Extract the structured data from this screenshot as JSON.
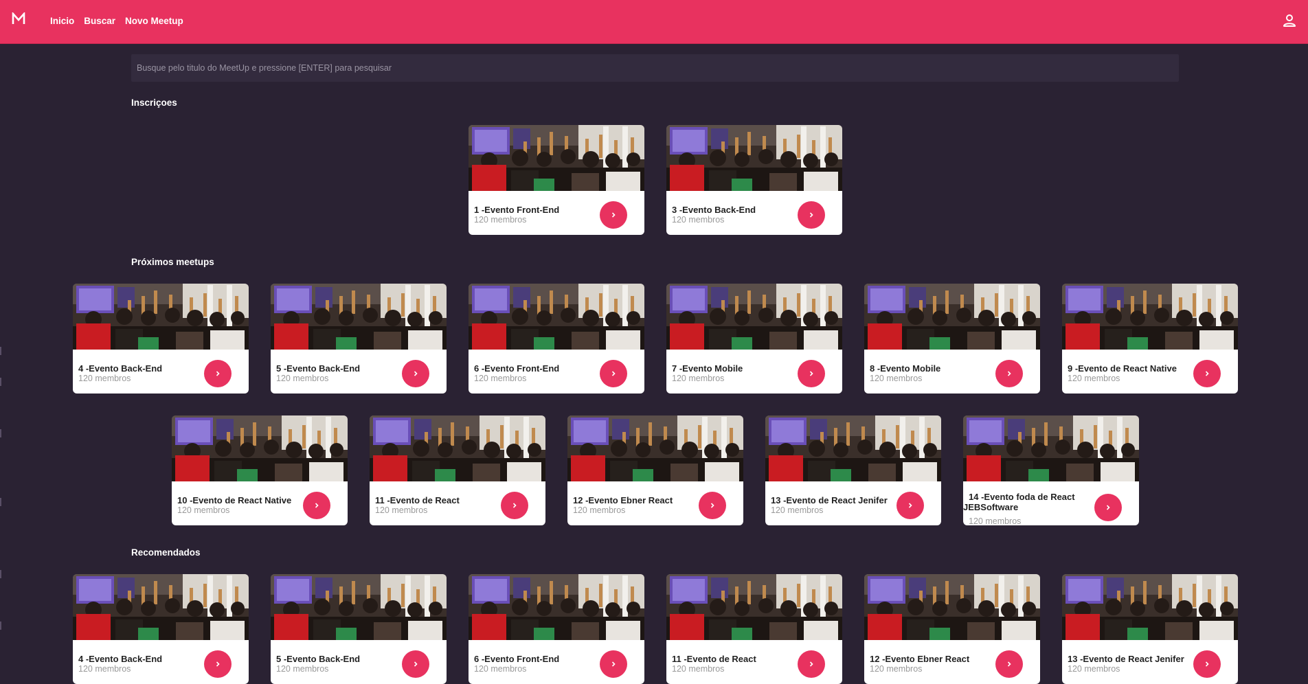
{
  "nav": {
    "logo": "M",
    "items": [
      "Inicio",
      "Buscar",
      "Novo Meetup"
    ]
  },
  "search": {
    "placeholder": "Busque pelo titulo do MeetUp e pressione [ENTER] para pesquisar"
  },
  "sections": {
    "inscricoes": {
      "title": "Inscriçoes",
      "cards": [
        {
          "title": "1 -Evento Front-End",
          "members": "120 membros"
        },
        {
          "title": "3 -Evento Back-End",
          "members": "120 membros"
        }
      ]
    },
    "proximos": {
      "title": "Próximos meetups",
      "cards": [
        {
          "title": "4 -Evento Back-End",
          "members": "120 membros"
        },
        {
          "title": "5 -Evento Back-End",
          "members": "120 membros"
        },
        {
          "title": "6 -Evento Front-End",
          "members": "120 membros"
        },
        {
          "title": "7 -Evento Mobile",
          "members": "120 membros"
        },
        {
          "title": "8 -Evento Mobile",
          "members": "120 membros"
        },
        {
          "title": "9 -Evento de React Native",
          "members": "120 membros"
        },
        {
          "title": "10 -Evento de React Native",
          "members": "120 membros"
        },
        {
          "title": "11 -Evento de React",
          "members": "120 membros"
        },
        {
          "title": "12 -Evento Ebner React",
          "members": "120 membros"
        },
        {
          "title": "13 -Evento de React Jenifer",
          "members": "120 membros"
        },
        {
          "title": "14 -Evento foda de React JEBSoftware",
          "members": "120 membros"
        }
      ]
    },
    "recomendados": {
      "title": "Recomendados",
      "cards": [
        {
          "title": "4 -Evento Back-End",
          "members": "120 membros"
        },
        {
          "title": "5 -Evento Back-End",
          "members": "120 membros"
        },
        {
          "title": "6 -Evento Front-End",
          "members": "120 membros"
        },
        {
          "title": "11 -Evento de React",
          "members": "120 membros"
        },
        {
          "title": "12 -Evento Ebner React",
          "members": "120 membros"
        },
        {
          "title": "13 -Evento de React Jenifer",
          "members": "120 membros"
        }
      ]
    }
  },
  "colors": {
    "brand": "#e8325f",
    "background": "#2a2233",
    "search_bg": "#332b3e"
  },
  "icons": {
    "logo": "m-logo-icon",
    "user": "user-icon",
    "card_action": "chevron-right-icon",
    "card_image": "event-photo"
  }
}
